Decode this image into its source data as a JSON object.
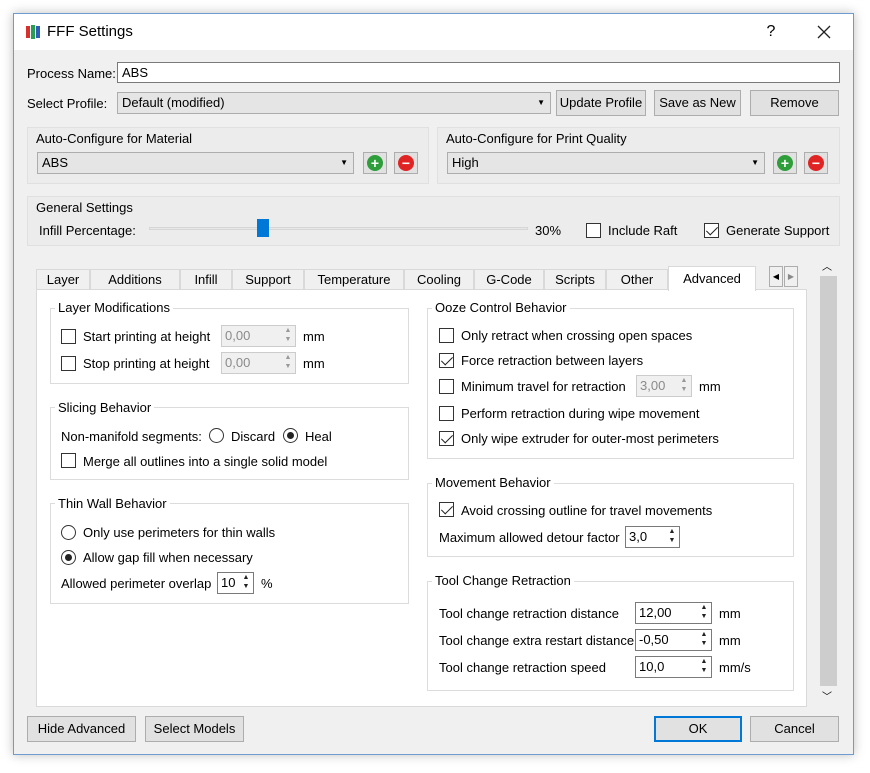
{
  "window": {
    "title": "FFF Settings",
    "help": "?",
    "close": "✕"
  },
  "process": {
    "label": "Process Name:",
    "value": "ABS"
  },
  "profile": {
    "label": "Select Profile:",
    "selected": "Default (modified)",
    "update_label": "Update Profile",
    "save_new_label": "Save as New",
    "remove_label": "Remove"
  },
  "material": {
    "title": "Auto-Configure for Material",
    "selected": "ABS"
  },
  "quality": {
    "title": "Auto-Configure for Print Quality",
    "selected": "High"
  },
  "general": {
    "title": "General Settings",
    "infill_label": "Infill Percentage:",
    "infill_value": "30%",
    "infill_fraction": 0.3,
    "raft_label": "Include Raft",
    "raft_checked": false,
    "support_label": "Generate Support",
    "support_checked": true
  },
  "tabs": [
    "Layer",
    "Additions",
    "Infill",
    "Support",
    "Temperature",
    "Cooling",
    "G-Code",
    "Scripts",
    "Other",
    "Advanced"
  ],
  "active_tab": "Advanced",
  "layer_mods": {
    "title": "Layer Modifications",
    "start_label": "Start printing at height",
    "start_value": "0,00",
    "stop_label": "Stop printing at height",
    "stop_value": "0,00",
    "unit": "mm"
  },
  "slicing": {
    "title": "Slicing Behavior",
    "nonmanifold_label": "Non-manifold segments:",
    "discard_label": "Discard",
    "heal_label": "Heal",
    "merge_label": "Merge all outlines into a single solid model"
  },
  "thinwall": {
    "title": "Thin Wall Behavior",
    "only_perimeters_label": "Only use perimeters for thin walls",
    "gap_fill_label": "Allow gap fill when necessary",
    "overlap_label": "Allowed perimeter overlap",
    "overlap_value": "10",
    "overlap_unit": "%"
  },
  "ooze": {
    "title": "Ooze Control Behavior",
    "only_retract_label": "Only retract when crossing open spaces",
    "force_retract_label": "Force retraction between layers",
    "min_travel_label": "Minimum travel for retraction",
    "min_travel_value": "3,00",
    "min_travel_unit": "mm",
    "wipe_retract_label": "Perform retraction during wipe movement",
    "wipe_outer_label": "Only wipe extruder for outer-most perimeters"
  },
  "movement": {
    "title": "Movement Behavior",
    "avoid_label": "Avoid crossing outline for travel movements",
    "detour_label": "Maximum allowed detour factor",
    "detour_value": "3,0"
  },
  "toolchange": {
    "title": "Tool Change Retraction",
    "distance_label": "Tool change retraction distance",
    "distance_value": "12,00",
    "distance_unit": "mm",
    "extra_label": "Tool change extra restart distance",
    "extra_value": "-0,50",
    "extra_unit": "mm",
    "speed_label": "Tool change retraction speed",
    "speed_value": "10,0",
    "speed_unit": "mm/s"
  },
  "footer": {
    "hide_advanced_label": "Hide Advanced",
    "select_models_label": "Select Models",
    "ok_label": "OK",
    "cancel_label": "Cancel"
  },
  "colors": {
    "accent": "#0078d7",
    "add": "#2e9e3b",
    "remove": "#e02424"
  }
}
